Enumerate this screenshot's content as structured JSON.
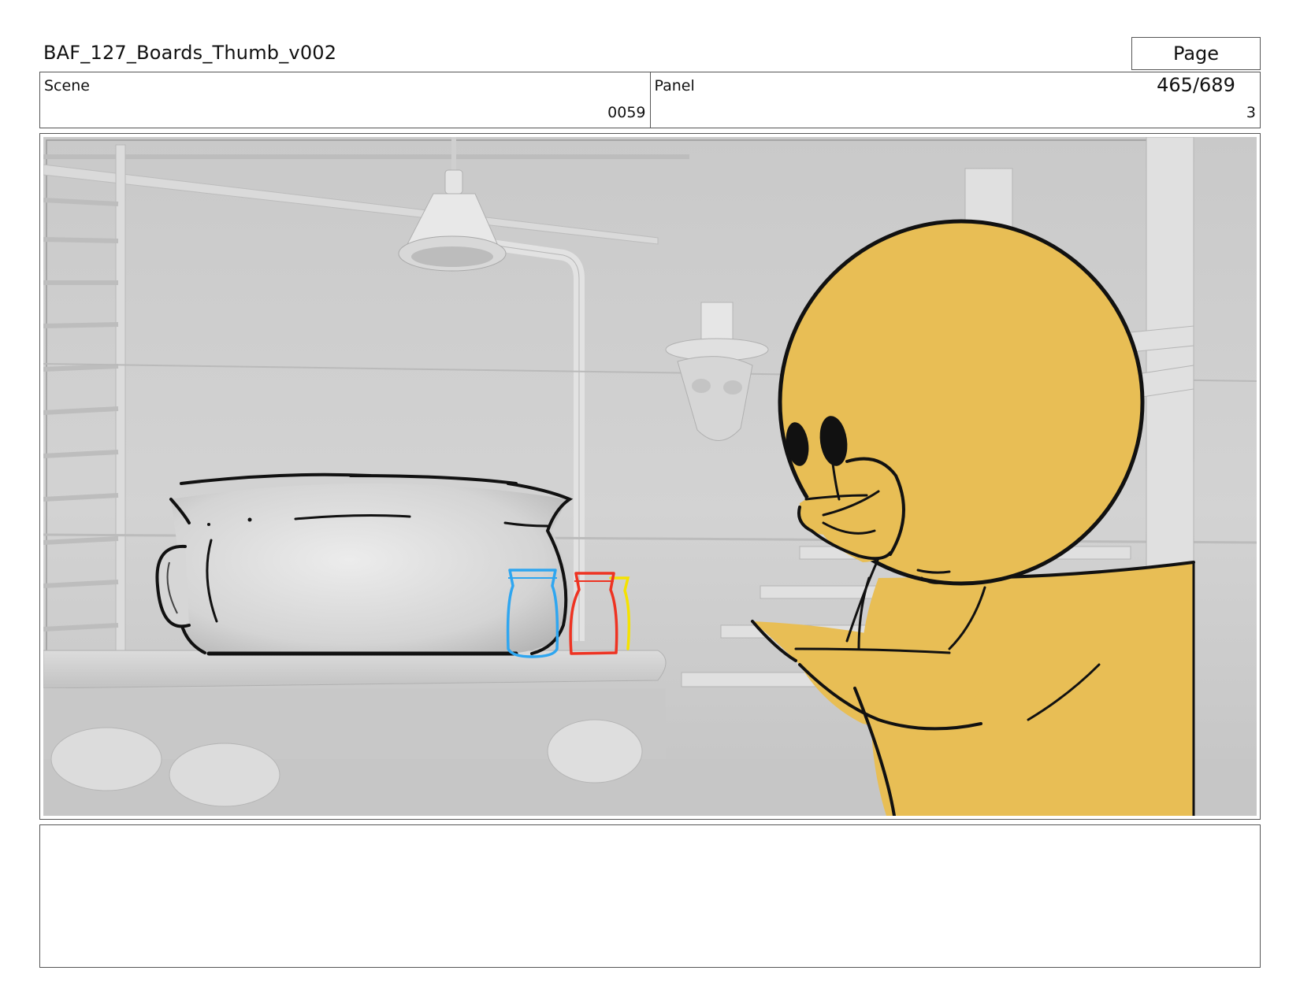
{
  "document": {
    "title": "BAF_127_Boards_Thumb_v002",
    "page_label": "Page 465/689"
  },
  "scene": {
    "label": "Scene",
    "value": "0059"
  },
  "panel": {
    "label": "Panel",
    "value": "3"
  },
  "notes": {
    "text": ""
  },
  "colors": {
    "duck_body": "#E8BE55",
    "jar_blue": "#2FA6F0",
    "jar_red": "#EE3322",
    "jar_yellow": "#F5E200",
    "background_gray": "#D0D0D0"
  }
}
